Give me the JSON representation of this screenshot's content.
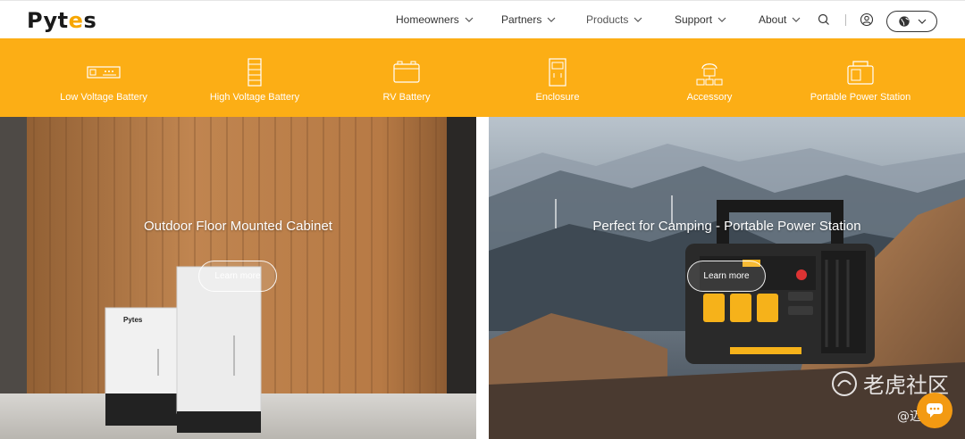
{
  "brand": {
    "logo_left": "Pyt",
    "logo_mid": "e",
    "logo_right": "s"
  },
  "nav": {
    "items": [
      {
        "label": "Homeowners"
      },
      {
        "label": "Partners"
      },
      {
        "label": "Products"
      },
      {
        "label": "Support"
      },
      {
        "label": "About"
      }
    ],
    "icons": [
      "search-icon",
      "user-icon",
      "globe-icon"
    ]
  },
  "categories": [
    {
      "label": "Low Voltage Battery",
      "icon": "low-voltage-battery-icon"
    },
    {
      "label": "High Voltage Battery",
      "icon": "high-voltage-battery-icon"
    },
    {
      "label": "RV Battery",
      "icon": "rv-battery-icon"
    },
    {
      "label": "Enclosure",
      "icon": "enclosure-icon"
    },
    {
      "label": "Accessory",
      "icon": "accessory-icon"
    },
    {
      "label": "Portable Power Station",
      "icon": "portable-power-station-icon"
    }
  ],
  "banners": [
    {
      "title": "Outdoor Floor Mounted Cabinet",
      "button": "Learn more",
      "product_logo": "Pytes"
    },
    {
      "title": "Perfect for Camping - Portable Power Station",
      "button": "Learn more"
    }
  ],
  "watermark": {
    "main": "老虎社区",
    "sub": "@迈富时"
  },
  "colors": {
    "accent": "#fcae15",
    "text": "#333333",
    "white": "#ffffff"
  }
}
